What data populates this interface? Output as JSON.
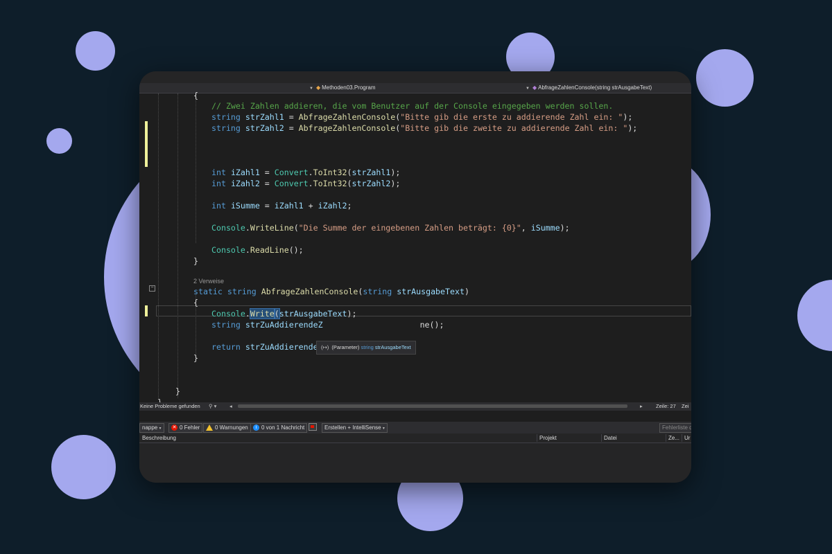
{
  "nav": {
    "project_dropdown": "Methoden03.Program",
    "member_dropdown": "AbfrageZahlenConsole(string strAusgabeText)"
  },
  "code": {
    "open_brace_top": "{",
    "comment": "// Zwei Zahlen addieren, die vom Benutzer auf der Console eingegeben werden sollen.",
    "l1_type": "string",
    "l1_var": "strZahl1",
    "l1_op": " = ",
    "l1_fn": "AbfrageZahlenConsole",
    "l1_arg": "\"Bitte gib die erste zu addierende Zahl ein: \"",
    "l1_end": ");",
    "l2_type": "string",
    "l2_var": "strZahl2",
    "l2_op": " = ",
    "l2_fn": "AbfrageZahlenConsole",
    "l2_arg": "\"Bitte gib die zweite zu addierende Zahl ein: \"",
    "l2_end": ");",
    "l3_type": "int",
    "l3_var": "iZahl1",
    "l3_op": " = ",
    "l3_cls": "Convert",
    "l3_fn": "ToInt32",
    "l3_arg": "strZahl1",
    "l3_end": ");",
    "l4_type": "int",
    "l4_var": "iZahl2",
    "l4_op": " = ",
    "l4_cls": "Convert",
    "l4_fn": "ToInt32",
    "l4_arg": "strZahl2",
    "l4_end": ");",
    "l5_type": "int",
    "l5_var": "iSumme",
    "l5_rest": " = ",
    "l5_a": "iZahl1",
    "l5_plus": " + ",
    "l5_b": "iZahl2",
    "l5_end": ";",
    "l6_cls": "Console",
    "l6_fn": "WriteLine",
    "l6_arg": "\"Die Summe der eingebenen Zahlen beträgt: {0}\"",
    "l6_sep": ", ",
    "l6_var": "iSumme",
    "l6_end": ");",
    "l7_cls": "Console",
    "l7_fn": "ReadLine",
    "l7_end": "();",
    "close1": "}",
    "codelens": "2 Verweise",
    "sig_static": "static",
    "sig_type": "string",
    "sig_name": "AbfrageZahlenConsole",
    "sig_ptype": "string",
    "sig_pname": "strAusgabeText",
    "sig_end": ")",
    "open2": "{",
    "m1_cls": "Console",
    "m1_fn": "Write",
    "m1_arg": "strAusgabeText",
    "m1_end": ");",
    "m2_type": "string",
    "m2_var": "strZuAddierendeZ",
    "m2_tail": "ne();",
    "m3_kw": "return",
    "m3_var": "strZuAddierendeZahl",
    "m3_end": ";",
    "close2": "}",
    "close3": "}",
    "close4": "}"
  },
  "tooltip": {
    "icon": "(↦)",
    "label": "(Parameter)",
    "type": "string",
    "name": "strAusgabeText"
  },
  "status": {
    "problems": "Keine Probleme gefunden",
    "line": "Zeile: 27",
    "col": "Zei"
  },
  "error_list": {
    "scope": "nappe",
    "errors": "0 Fehler",
    "warnings": "0 Warnungen",
    "messages": "0 von 1 Nachricht",
    "build_filter": "Erstellen + IntelliSense",
    "search": "Fehlerliste d",
    "columns": [
      "Beschreibung",
      "Projekt",
      "Datei",
      "Ze...",
      "Ur"
    ]
  }
}
